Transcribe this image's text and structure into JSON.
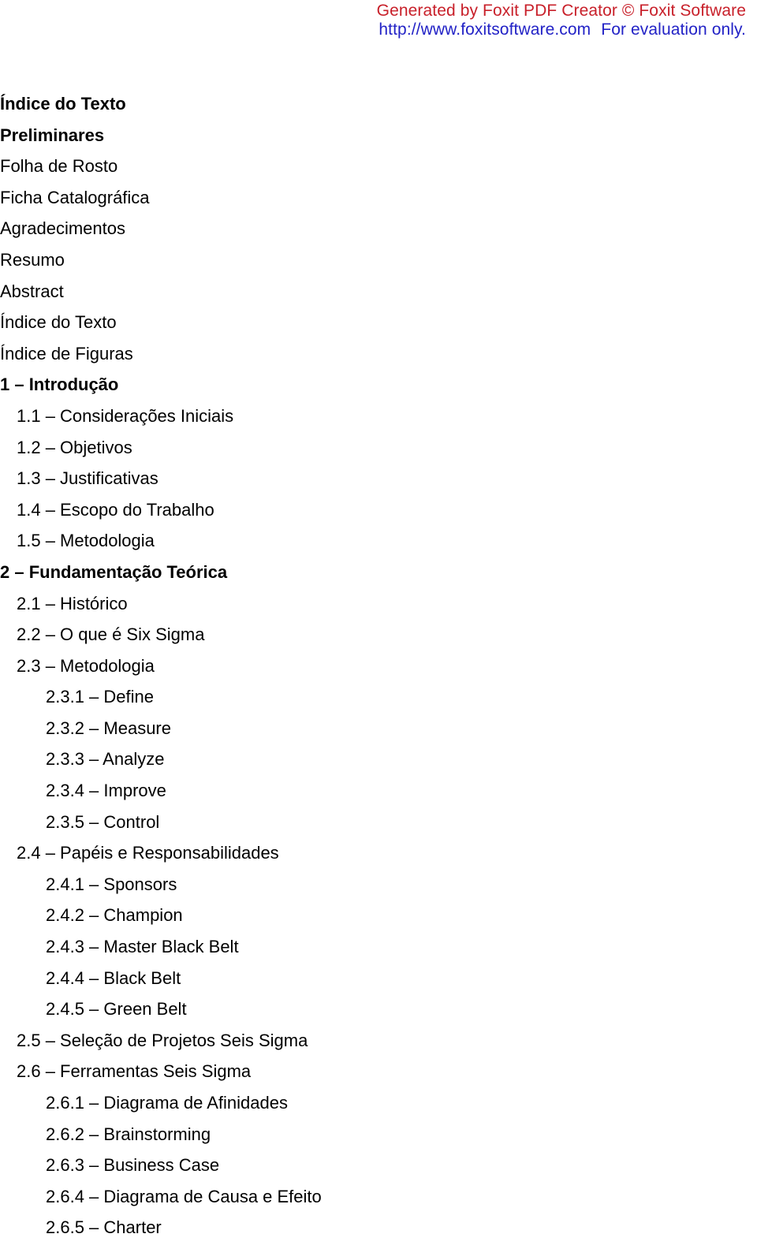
{
  "watermark": {
    "line1": "Generated by Foxit PDF Creator © Foxit Software",
    "line2_url": "http://www.foxitsoftware.com",
    "line2_note": "For evaluation only.",
    "color_line1": "#C8202A",
    "color_line2": "#2222C6"
  },
  "document": {
    "title": "Índice do Texto",
    "entries": [
      {
        "text": "Índice do Texto",
        "level": 0,
        "bold": true
      },
      {
        "text": "Preliminares",
        "level": 0,
        "bold": true
      },
      {
        "text": "Folha de Rosto",
        "level": 0,
        "bold": false
      },
      {
        "text": "Ficha Catalográfica",
        "level": 0,
        "bold": false
      },
      {
        "text": "Agradecimentos",
        "level": 0,
        "bold": false
      },
      {
        "text": "Resumo",
        "level": 0,
        "bold": false
      },
      {
        "text": "Abstract",
        "level": 0,
        "bold": false
      },
      {
        "text": "Índice do Texto",
        "level": 0,
        "bold": false
      },
      {
        "text": "Índice de Figuras",
        "level": 0,
        "bold": false
      },
      {
        "text": "1 – Introdução",
        "level": 0,
        "bold": true
      },
      {
        "text": "1.1 – Considerações Iniciais",
        "level": 1,
        "bold": false
      },
      {
        "text": "1.2 – Objetivos",
        "level": 1,
        "bold": false
      },
      {
        "text": "1.3 – Justificativas",
        "level": 1,
        "bold": false
      },
      {
        "text": "1.4 – Escopo do Trabalho",
        "level": 1,
        "bold": false
      },
      {
        "text": "1.5 – Metodologia",
        "level": 1,
        "bold": false
      },
      {
        "text": "2 – Fundamentação Teórica",
        "level": 0,
        "bold": true
      },
      {
        "text": "2.1 – Histórico",
        "level": 1,
        "bold": false
      },
      {
        "text": "2.2 – O que é Six Sigma",
        "level": 1,
        "bold": false
      },
      {
        "text": "2.3 – Metodologia",
        "level": 1,
        "bold": false
      },
      {
        "text": "2.3.1 – Define",
        "level": 2,
        "bold": false
      },
      {
        "text": "2.3.2 – Measure",
        "level": 2,
        "bold": false
      },
      {
        "text": "2.3.3 – Analyze",
        "level": 2,
        "bold": false
      },
      {
        "text": "2.3.4 – Improve",
        "level": 2,
        "bold": false
      },
      {
        "text": "2.3.5 – Control",
        "level": 2,
        "bold": false
      },
      {
        "text": "2.4 – Papéis e Responsabilidades",
        "level": 1,
        "bold": false
      },
      {
        "text": "2.4.1 – Sponsors",
        "level": 2,
        "bold": false
      },
      {
        "text": "2.4.2 – Champion",
        "level": 2,
        "bold": false
      },
      {
        "text": "2.4.3 – Master Black Belt",
        "level": 2,
        "bold": false
      },
      {
        "text": "2.4.4 – Black Belt",
        "level": 2,
        "bold": false
      },
      {
        "text": "2.4.5 – Green Belt",
        "level": 2,
        "bold": false
      },
      {
        "text": "2.5 – Seleção de Projetos Seis Sigma",
        "level": 1,
        "bold": false
      },
      {
        "text": "2.6 – Ferramentas Seis Sigma",
        "level": 1,
        "bold": false
      },
      {
        "text": "2.6.1 – Diagrama de Afinidades",
        "level": 2,
        "bold": false
      },
      {
        "text": "2.6.2 – Brainstorming",
        "level": 2,
        "bold": false
      },
      {
        "text": "2.6.3 – Business Case",
        "level": 2,
        "bold": false
      },
      {
        "text": "2.6.4 – Diagrama de Causa e Efeito",
        "level": 2,
        "bold": false
      },
      {
        "text": "2.6.5 – Charter",
        "level": 2,
        "bold": false
      }
    ]
  }
}
